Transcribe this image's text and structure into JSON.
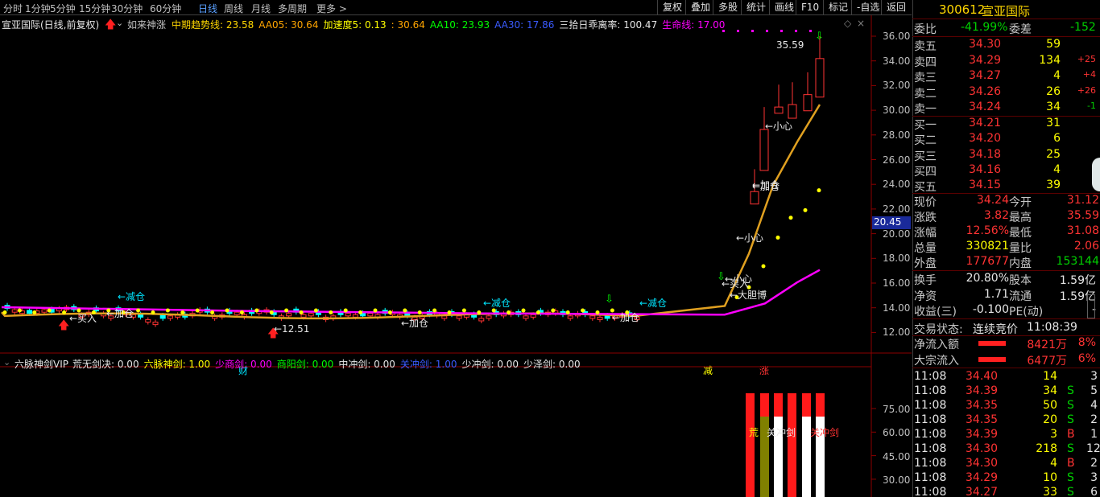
{
  "periods": [
    "分时",
    "1分钟",
    "5分钟",
    "15分钟",
    "30分钟",
    "60分钟",
    "日线",
    "周线",
    "月线",
    "多周期",
    "更多 >"
  ],
  "active_period": "日线",
  "tools": [
    "复权",
    "叠加",
    "多股",
    "统计",
    "画线",
    "F10",
    "标记",
    "-自选",
    "返回"
  ],
  "indicator": {
    "name": "宣亚国际(日线,前复权)",
    "formula": "如来神涨",
    "items": [
      {
        "text": "中期趋势线: 23.58",
        "color": "#ffd700"
      },
      {
        "text": "AA05: 30.64",
        "color": "#ffa500"
      },
      {
        "text": "加速度5: 0.13",
        "color": "#ffff00"
      },
      {
        "text": ": 30.64",
        "color": "#ffa500"
      },
      {
        "text": "AA10: 23.93",
        "color": "#00ff00"
      },
      {
        "text": "AA30: 17.86",
        "color": "#3a5bff"
      },
      {
        "text": "三拾日乖离率: 100.47",
        "color": "#e6e6e6"
      },
      {
        "text": "生命线: 17.00",
        "color": "#ff00ff"
      }
    ]
  },
  "indicator2": {
    "name": "六脉神剑VIP",
    "items": [
      {
        "text": "荒无剑决: 0.00",
        "color": "#e6e6e6"
      },
      {
        "text": "六脉神剑: 1.00",
        "color": "#ffff00"
      },
      {
        "text": "少商剑: 0.00",
        "color": "#ff00ff"
      },
      {
        "text": "商阳剑: 0.00",
        "color": "#00ff00"
      },
      {
        "text": "中冲剑: 0.00",
        "color": "#e6e6e6"
      },
      {
        "text": "关冲剑: 1.00",
        "color": "#3a5bff"
      },
      {
        "text": "少冲剑: 0.00",
        "color": "#e6e6e6"
      },
      {
        "text": "少泽剑: 0.00",
        "color": "#e6e6e6"
      }
    ]
  },
  "price_axis": [
    "36.00",
    "34.00",
    "32.00",
    "30.00",
    "28.00",
    "26.00",
    "24.00",
    "22.00",
    "20.00",
    "18.00",
    "16.00",
    "14.00",
    "12.00"
  ],
  "cursor_price": "20.45",
  "sub_axis": [
    "75.00",
    "60.00",
    "45.00",
    "30.00",
    "15.00"
  ],
  "annotations": {
    "high": "35.59",
    "low": "12.51",
    "signals": [
      "←减仓",
      "←买入",
      "←加仓",
      "←减仓",
      "←加仓",
      "←减仓",
      "←加仓",
      "←加仓",
      "←小心",
      "←小心",
      "←加仓",
      "←小心",
      "←买入",
      "←大胆博"
    ],
    "markers": [
      "财",
      "减",
      "涨"
    ],
    "sword_labels": [
      "荒",
      "关冲剑",
      "关冲剑"
    ]
  },
  "quote": {
    "code": "300612",
    "name": "宣亚国际",
    "webi_label": "委比",
    "webi": "-41.99%",
    "weicha_label": "委差",
    "weicha": "-152",
    "asks": [
      {
        "label": "卖五",
        "price": "34.30",
        "vol": "59",
        "chg": ""
      },
      {
        "label": "卖四",
        "price": "34.29",
        "vol": "134",
        "chg": "+25"
      },
      {
        "label": "卖三",
        "price": "34.27",
        "vol": "4",
        "chg": "+4"
      },
      {
        "label": "卖二",
        "price": "34.26",
        "vol": "26",
        "chg": "+26"
      },
      {
        "label": "卖一",
        "price": "34.24",
        "vol": "34",
        "chg": "-1"
      }
    ],
    "bids": [
      {
        "label": "买一",
        "price": "34.21",
        "vol": "31"
      },
      {
        "label": "买二",
        "price": "34.20",
        "vol": "6"
      },
      {
        "label": "买三",
        "price": "34.18",
        "vol": "25"
      },
      {
        "label": "买四",
        "price": "34.16",
        "vol": "4"
      },
      {
        "label": "买五",
        "price": "34.15",
        "vol": "39"
      }
    ],
    "stats": [
      {
        "l1": "现价",
        "v1": "34.24",
        "c1": "red",
        "l2": "今开",
        "v2": "31.12",
        "c2": "red"
      },
      {
        "l1": "涨跌",
        "v1": "3.82",
        "c1": "red",
        "l2": "最高",
        "v2": "35.59",
        "c2": "red"
      },
      {
        "l1": "涨幅",
        "v1": "12.56%",
        "c1": "red",
        "l2": "最低",
        "v2": "31.08",
        "c2": "red"
      },
      {
        "l1": "总量",
        "v1": "330821",
        "c1": "yellow",
        "l2": "量比",
        "v2": "2.06",
        "c2": "red"
      },
      {
        "l1": "外盘",
        "v1": "177677",
        "c1": "red",
        "l2": "内盘",
        "v2": "153144",
        "c2": "green"
      }
    ],
    "stats2": [
      {
        "l1": "换手",
        "v1": "20.80%",
        "l2": "股本",
        "v2": "1.59亿"
      },
      {
        "l1": "净资",
        "v1": "1.71",
        "l2": "流通",
        "v2": "1.59亿"
      },
      {
        "l1": "收益(三)",
        "v1": "-0.100",
        "l2": "PE(动)",
        "v2": "-"
      }
    ],
    "trade_state_label": "交易状态:",
    "trade_state": "连续竞价",
    "trade_time": "11:08:39",
    "flows": [
      {
        "label": "净流入额",
        "value": "8421万",
        "pct": "8%"
      },
      {
        "label": "大宗流入",
        "value": "6477万",
        "pct": "6%"
      }
    ],
    "ticks": [
      {
        "time": "11:08",
        "price": "34.40",
        "vol": "14",
        "side": "",
        "n": "3"
      },
      {
        "time": "11:08",
        "price": "34.39",
        "vol": "34",
        "side": "S",
        "n": "5"
      },
      {
        "time": "11:08",
        "price": "34.35",
        "vol": "50",
        "side": "S",
        "n": "4"
      },
      {
        "time": "11:08",
        "price": "34.35",
        "vol": "20",
        "side": "S",
        "n": "2"
      },
      {
        "time": "11:08",
        "price": "34.39",
        "vol": "3",
        "side": "B",
        "n": "1"
      },
      {
        "time": "11:08",
        "price": "34.30",
        "vol": "218",
        "side": "S",
        "n": "12"
      },
      {
        "time": "11:08",
        "price": "34.30",
        "vol": "4",
        "side": "B",
        "n": "2"
      },
      {
        "time": "11:08",
        "price": "34.29",
        "vol": "10",
        "side": "S",
        "n": "3"
      },
      {
        "time": "11:08",
        "price": "34.27",
        "vol": "33",
        "side": "S",
        "n": "6"
      }
    ]
  },
  "colors": {
    "up": "#ff3333",
    "down": "#00ffff",
    "ma_mid": "#e0a020",
    "life": "#ff00ff",
    "dots": "#ffff00",
    "sword_red": "#ff1a1a",
    "sword_white": "#ffffff",
    "sword_olive": "#808000"
  }
}
